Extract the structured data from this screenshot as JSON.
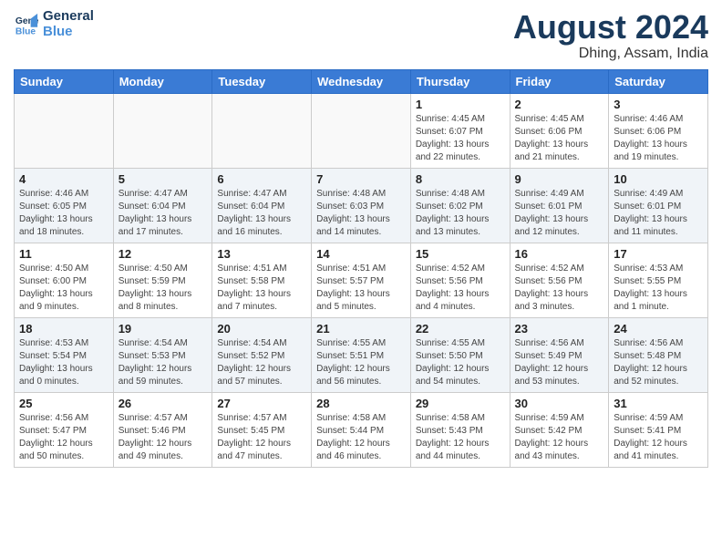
{
  "header": {
    "logo_line1": "General",
    "logo_line2": "Blue",
    "month_year": "August 2024",
    "location": "Dhing, Assam, India"
  },
  "weekdays": [
    "Sunday",
    "Monday",
    "Tuesday",
    "Wednesday",
    "Thursday",
    "Friday",
    "Saturday"
  ],
  "weeks": [
    [
      {
        "day": "",
        "info": ""
      },
      {
        "day": "",
        "info": ""
      },
      {
        "day": "",
        "info": ""
      },
      {
        "day": "",
        "info": ""
      },
      {
        "day": "1",
        "info": "Sunrise: 4:45 AM\nSunset: 6:07 PM\nDaylight: 13 hours\nand 22 minutes."
      },
      {
        "day": "2",
        "info": "Sunrise: 4:45 AM\nSunset: 6:06 PM\nDaylight: 13 hours\nand 21 minutes."
      },
      {
        "day": "3",
        "info": "Sunrise: 4:46 AM\nSunset: 6:06 PM\nDaylight: 13 hours\nand 19 minutes."
      }
    ],
    [
      {
        "day": "4",
        "info": "Sunrise: 4:46 AM\nSunset: 6:05 PM\nDaylight: 13 hours\nand 18 minutes."
      },
      {
        "day": "5",
        "info": "Sunrise: 4:47 AM\nSunset: 6:04 PM\nDaylight: 13 hours\nand 17 minutes."
      },
      {
        "day": "6",
        "info": "Sunrise: 4:47 AM\nSunset: 6:04 PM\nDaylight: 13 hours\nand 16 minutes."
      },
      {
        "day": "7",
        "info": "Sunrise: 4:48 AM\nSunset: 6:03 PM\nDaylight: 13 hours\nand 14 minutes."
      },
      {
        "day": "8",
        "info": "Sunrise: 4:48 AM\nSunset: 6:02 PM\nDaylight: 13 hours\nand 13 minutes."
      },
      {
        "day": "9",
        "info": "Sunrise: 4:49 AM\nSunset: 6:01 PM\nDaylight: 13 hours\nand 12 minutes."
      },
      {
        "day": "10",
        "info": "Sunrise: 4:49 AM\nSunset: 6:01 PM\nDaylight: 13 hours\nand 11 minutes."
      }
    ],
    [
      {
        "day": "11",
        "info": "Sunrise: 4:50 AM\nSunset: 6:00 PM\nDaylight: 13 hours\nand 9 minutes."
      },
      {
        "day": "12",
        "info": "Sunrise: 4:50 AM\nSunset: 5:59 PM\nDaylight: 13 hours\nand 8 minutes."
      },
      {
        "day": "13",
        "info": "Sunrise: 4:51 AM\nSunset: 5:58 PM\nDaylight: 13 hours\nand 7 minutes."
      },
      {
        "day": "14",
        "info": "Sunrise: 4:51 AM\nSunset: 5:57 PM\nDaylight: 13 hours\nand 5 minutes."
      },
      {
        "day": "15",
        "info": "Sunrise: 4:52 AM\nSunset: 5:56 PM\nDaylight: 13 hours\nand 4 minutes."
      },
      {
        "day": "16",
        "info": "Sunrise: 4:52 AM\nSunset: 5:56 PM\nDaylight: 13 hours\nand 3 minutes."
      },
      {
        "day": "17",
        "info": "Sunrise: 4:53 AM\nSunset: 5:55 PM\nDaylight: 13 hours\nand 1 minute."
      }
    ],
    [
      {
        "day": "18",
        "info": "Sunrise: 4:53 AM\nSunset: 5:54 PM\nDaylight: 13 hours\nand 0 minutes."
      },
      {
        "day": "19",
        "info": "Sunrise: 4:54 AM\nSunset: 5:53 PM\nDaylight: 12 hours\nand 59 minutes."
      },
      {
        "day": "20",
        "info": "Sunrise: 4:54 AM\nSunset: 5:52 PM\nDaylight: 12 hours\nand 57 minutes."
      },
      {
        "day": "21",
        "info": "Sunrise: 4:55 AM\nSunset: 5:51 PM\nDaylight: 12 hours\nand 56 minutes."
      },
      {
        "day": "22",
        "info": "Sunrise: 4:55 AM\nSunset: 5:50 PM\nDaylight: 12 hours\nand 54 minutes."
      },
      {
        "day": "23",
        "info": "Sunrise: 4:56 AM\nSunset: 5:49 PM\nDaylight: 12 hours\nand 53 minutes."
      },
      {
        "day": "24",
        "info": "Sunrise: 4:56 AM\nSunset: 5:48 PM\nDaylight: 12 hours\nand 52 minutes."
      }
    ],
    [
      {
        "day": "25",
        "info": "Sunrise: 4:56 AM\nSunset: 5:47 PM\nDaylight: 12 hours\nand 50 minutes."
      },
      {
        "day": "26",
        "info": "Sunrise: 4:57 AM\nSunset: 5:46 PM\nDaylight: 12 hours\nand 49 minutes."
      },
      {
        "day": "27",
        "info": "Sunrise: 4:57 AM\nSunset: 5:45 PM\nDaylight: 12 hours\nand 47 minutes."
      },
      {
        "day": "28",
        "info": "Sunrise: 4:58 AM\nSunset: 5:44 PM\nDaylight: 12 hours\nand 46 minutes."
      },
      {
        "day": "29",
        "info": "Sunrise: 4:58 AM\nSunset: 5:43 PM\nDaylight: 12 hours\nand 44 minutes."
      },
      {
        "day": "30",
        "info": "Sunrise: 4:59 AM\nSunset: 5:42 PM\nDaylight: 12 hours\nand 43 minutes."
      },
      {
        "day": "31",
        "info": "Sunrise: 4:59 AM\nSunset: 5:41 PM\nDaylight: 12 hours\nand 41 minutes."
      }
    ]
  ]
}
